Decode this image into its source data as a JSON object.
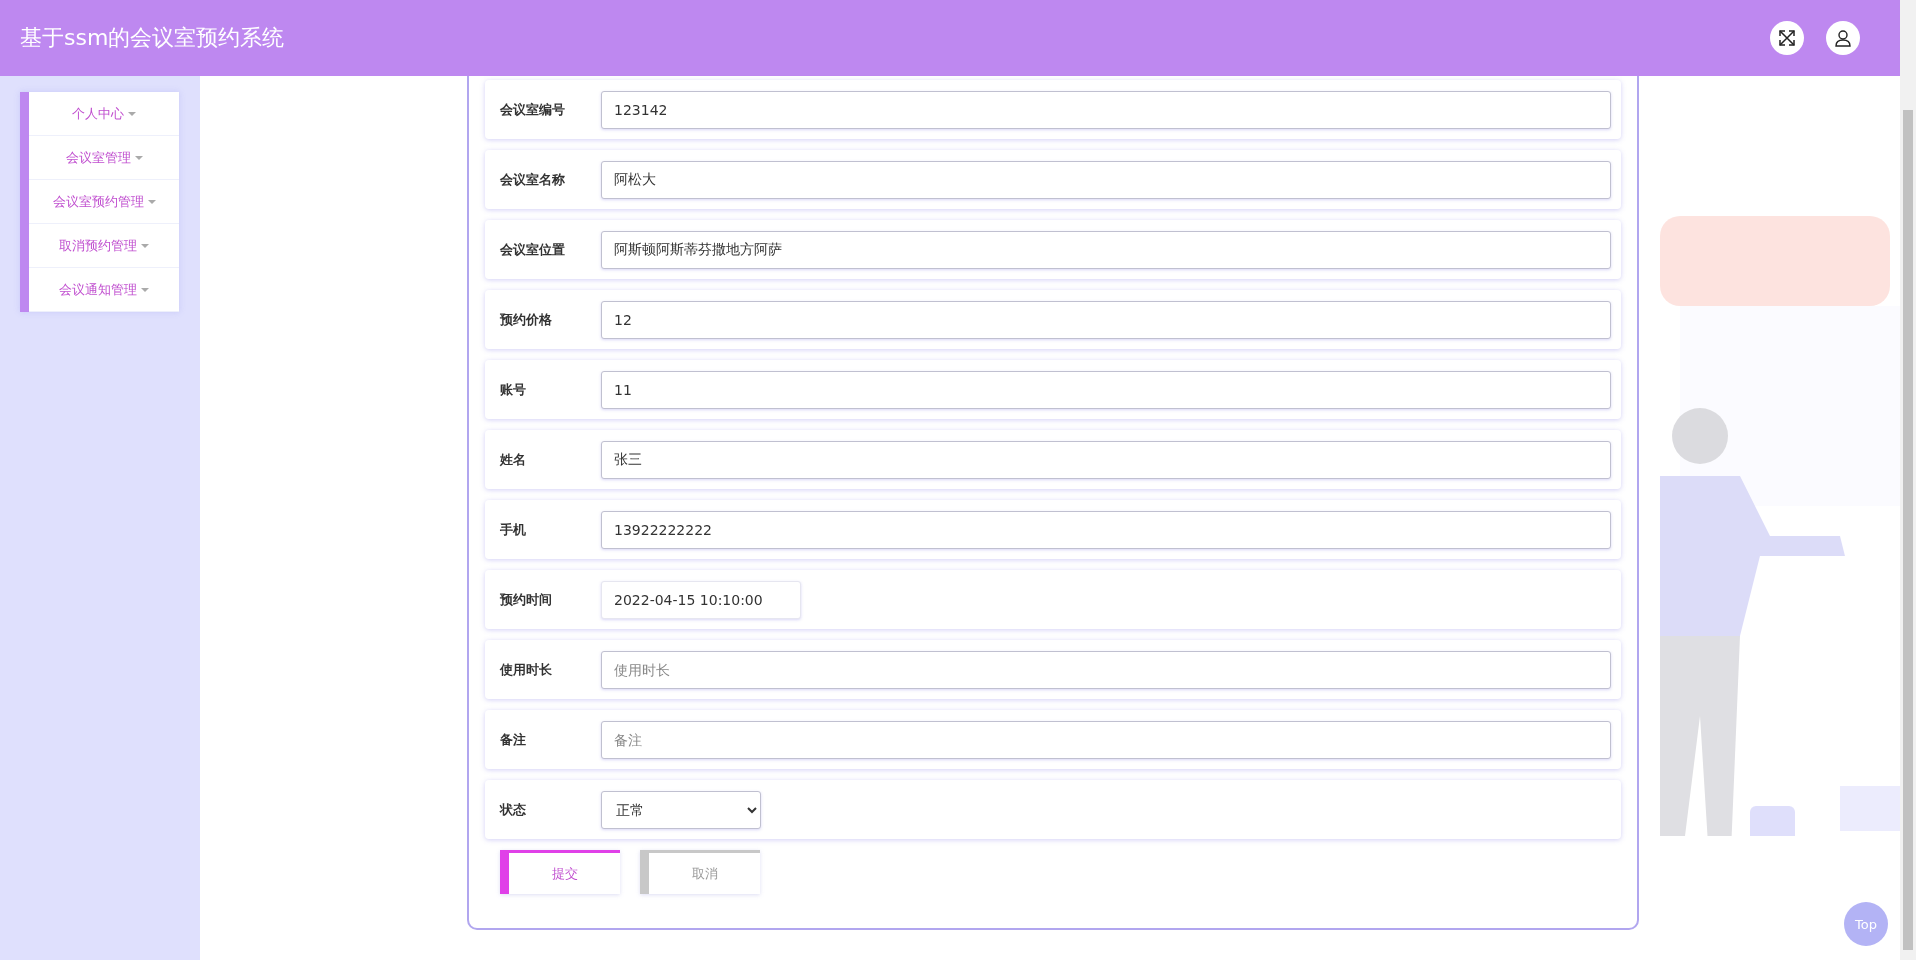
{
  "header": {
    "title": "基于ssm的会议室预约系统"
  },
  "sidebar": {
    "items": [
      {
        "label": "个人中心"
      },
      {
        "label": "会议室管理"
      },
      {
        "label": "会议室预约管理"
      },
      {
        "label": "取消预约管理"
      },
      {
        "label": "会议通知管理"
      }
    ]
  },
  "form": {
    "fields": [
      {
        "kind": "input",
        "label": "会议室编号",
        "value": "123142"
      },
      {
        "kind": "input",
        "label": "会议室名称",
        "value": "阿松大"
      },
      {
        "kind": "input",
        "label": "会议室位置",
        "value": "阿斯顿阿斯蒂芬撒地方阿萨"
      },
      {
        "kind": "input",
        "label": "预约价格",
        "value": "12"
      },
      {
        "kind": "input",
        "label": "账号",
        "value": "11"
      },
      {
        "kind": "input",
        "label": "姓名",
        "value": "张三"
      },
      {
        "kind": "input",
        "label": "手机",
        "value": "13922222222"
      },
      {
        "kind": "date",
        "label": "预约时间",
        "value": "2022-04-15 10:10:00"
      },
      {
        "kind": "input",
        "label": "使用时长",
        "placeholder": "使用时长"
      },
      {
        "kind": "input",
        "label": "备注",
        "placeholder": "备注"
      },
      {
        "kind": "select",
        "label": "状态",
        "value": "正常"
      }
    ],
    "buttons": [
      {
        "kind": "primary",
        "label": "提交"
      },
      {
        "kind": "secondary",
        "label": "取消"
      }
    ]
  },
  "back_to_top": "Top"
}
